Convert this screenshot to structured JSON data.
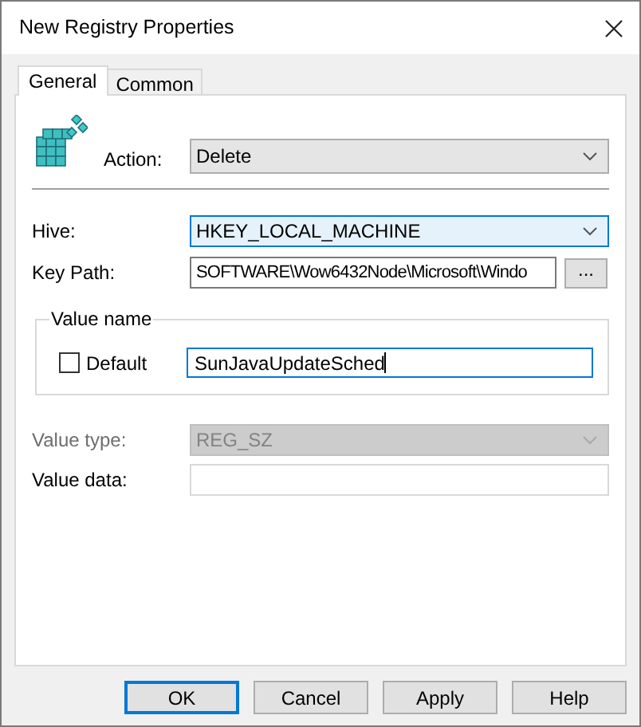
{
  "window": {
    "title": "New Registry Properties"
  },
  "tabs": [
    {
      "label": "General",
      "selected": true
    },
    {
      "label": "Common",
      "selected": false
    }
  ],
  "action": {
    "label": "Action:",
    "value": "Delete"
  },
  "hive": {
    "label": "Hive:",
    "value": "HKEY_LOCAL_MACHINE",
    "highlighted": true
  },
  "key_path": {
    "label": "Key Path:",
    "value": "SOFTWARE\\Wow6432Node\\Microsoft\\Windo",
    "browse": "..."
  },
  "value_name": {
    "title": "Value name",
    "default": {
      "label": "Default",
      "checked": false
    },
    "value": "SunJavaUpdateSched"
  },
  "value_type": {
    "label": "Value type:",
    "value": "REG_SZ",
    "disabled": true
  },
  "value_data": {
    "label": "Value data:",
    "disabled": false
  },
  "buttons": [
    {
      "label": "OK",
      "default": true
    },
    {
      "label": "Cancel",
      "default": false
    },
    {
      "label": "Apply",
      "default": false
    },
    {
      "label": "Help",
      "default": false
    }
  ]
}
